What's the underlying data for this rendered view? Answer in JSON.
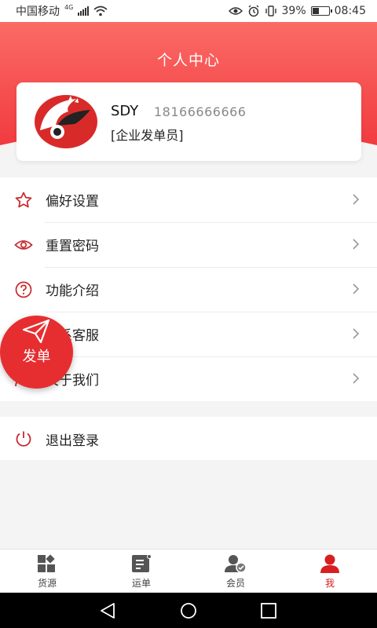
{
  "status_bar": {
    "carrier": "中国移动",
    "network": "4G",
    "battery_percent": "39%",
    "battery_level": 0.39,
    "time": "08:45"
  },
  "header": {
    "title": "个人中心"
  },
  "profile": {
    "name": "SDY",
    "phone": "18166666666",
    "role": "[企业发单员]"
  },
  "menu": [
    {
      "label": "偏好设置",
      "icon": "star-icon"
    },
    {
      "label": "重置密码",
      "icon": "eye-icon"
    },
    {
      "label": "功能介绍",
      "icon": "question-icon"
    },
    {
      "label": "联系客服",
      "icon": "headset-icon"
    },
    {
      "label": "关于我们",
      "icon": "people-icon"
    }
  ],
  "logout": {
    "label": "退出登录",
    "icon": "power-icon"
  },
  "fab": {
    "label": "发单",
    "icon": "paper-plane-icon"
  },
  "tabs": [
    {
      "label": "货源",
      "icon": "grid-icon",
      "active": false
    },
    {
      "label": "运单",
      "icon": "waybill-icon",
      "active": false
    },
    {
      "label": "会员",
      "icon": "member-icon",
      "active": false
    },
    {
      "label": "我",
      "icon": "person-icon",
      "active": true
    }
  ],
  "colors": {
    "accent": "#d81e21",
    "header_top": "#fb6b66",
    "header_bottom": "#f0363c",
    "fab": "#e62e31"
  }
}
